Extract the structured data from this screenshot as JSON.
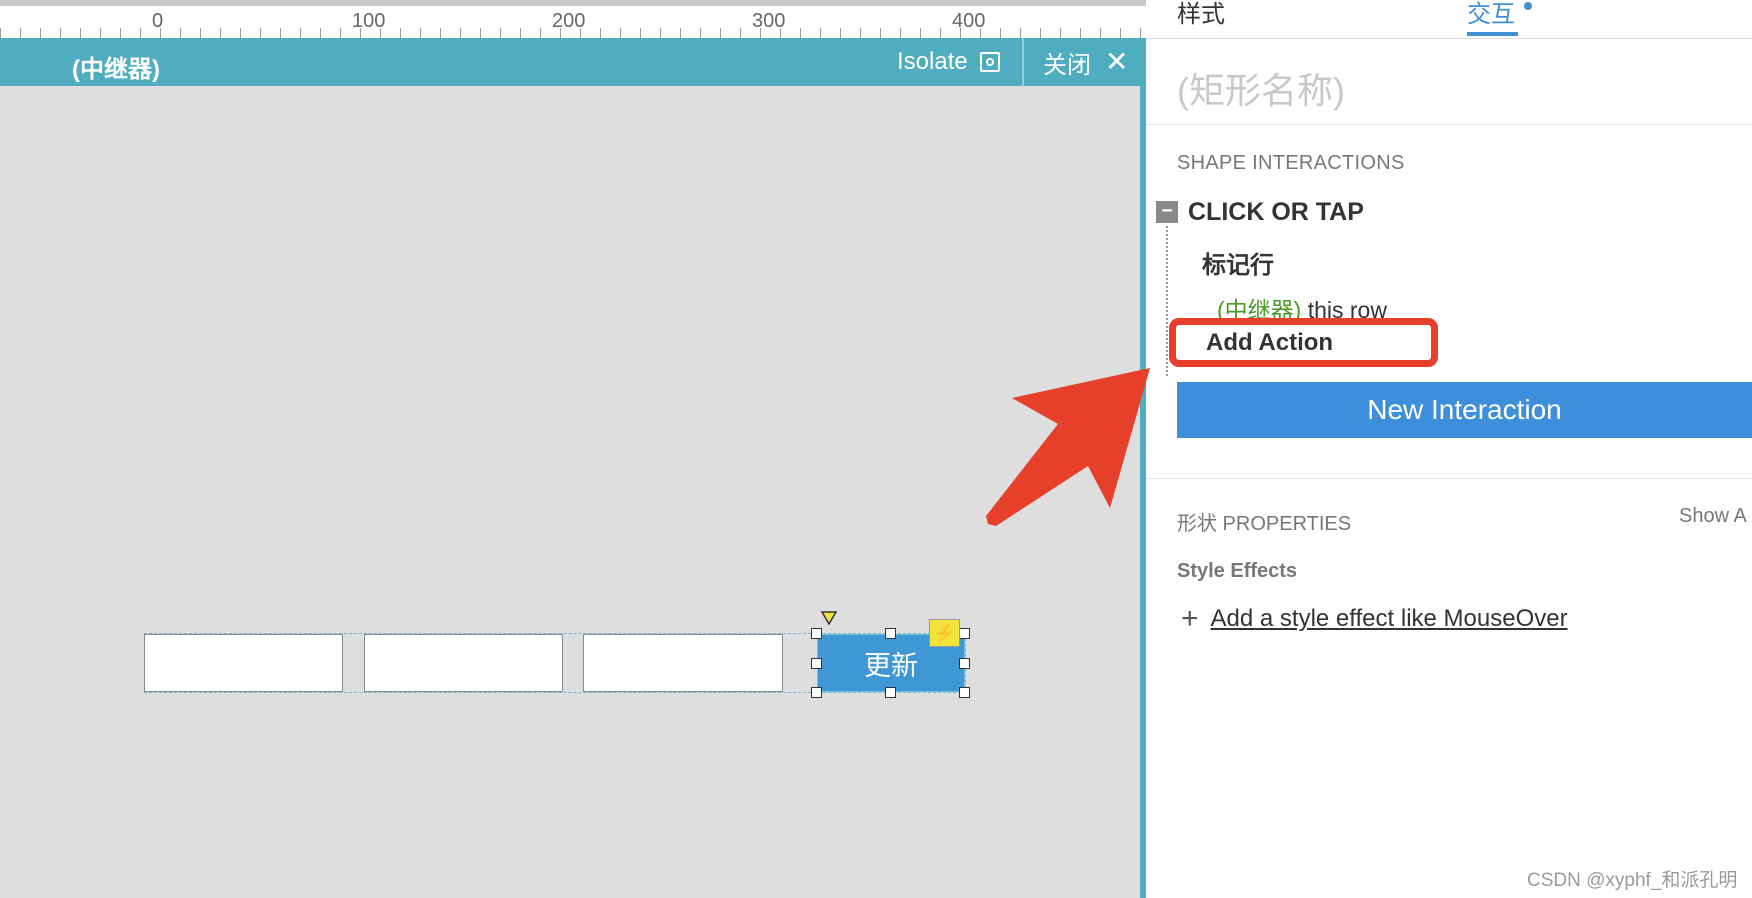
{
  "ruler": {
    "labels": [
      "0",
      "100",
      "200",
      "300",
      "400"
    ]
  },
  "repeater_bar": {
    "title": "(中继器)",
    "isolate_label": "Isolate",
    "close_label": "关闭"
  },
  "canvas": {
    "update_button_label": "更新"
  },
  "panel": {
    "tabs": [
      {
        "label": "样式"
      },
      {
        "label": "交互"
      }
    ],
    "shape_name_placeholder": "(矩形名称)",
    "section_title": "SHAPE INTERACTIONS",
    "event_label": "CLICK OR TAP",
    "case_label": "标记行",
    "action_target": "(中继器)",
    "action_text": "this row",
    "add_action_label": "Add Action",
    "new_interaction_label": "New Interaction",
    "properties_title": "形状 PROPERTIES",
    "show_all_label": "Show A",
    "style_effects_label": "Style Effects",
    "add_style_effect_label": "Add a style effect like MouseOver"
  },
  "watermark": "CSDN @xyphf_和派孔明",
  "colors": {
    "accent_teal": "#4fadbf",
    "accent_blue": "#3d8fdb",
    "highlight_red": "#e63f2a",
    "action_green": "#4a9a2a"
  }
}
